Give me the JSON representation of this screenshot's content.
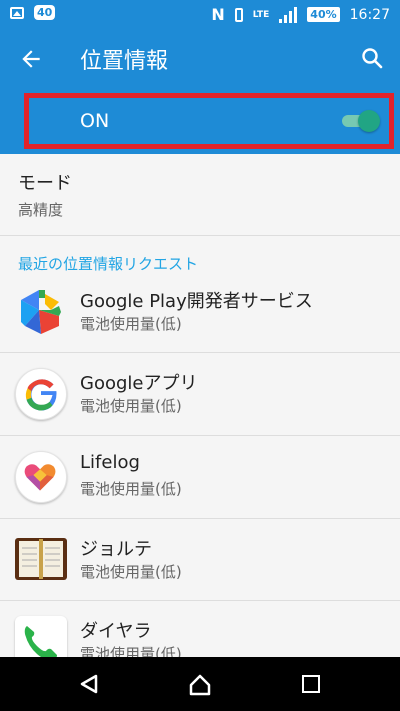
{
  "status_bar": {
    "notification_badge": "40",
    "network": "LTE",
    "battery": "40%",
    "time": "16:27"
  },
  "app_bar": {
    "title": "位置情報"
  },
  "location_toggle": {
    "label": "ON",
    "state": "on"
  },
  "mode": {
    "title": "モード",
    "value": "高精度"
  },
  "recent_requests": {
    "header": "最近の位置情報リクエスト",
    "apps": [
      {
        "name": "Google Play開発者サービス",
        "usage": "電池使用量(低)",
        "icon": "google-play-services-icon"
      },
      {
        "name": "Googleアプリ",
        "usage": "電池使用量(低)",
        "icon": "google-g-icon"
      },
      {
        "name": "Lifelog",
        "usage": "電池使用量(低)",
        "icon": "lifelog-heart-icon"
      },
      {
        "name": "ジョルテ",
        "usage": "電池使用量(低)",
        "icon": "jorte-notebook-icon"
      },
      {
        "name": "ダイヤラ",
        "usage": "電池使用量(低)",
        "icon": "phone-dialer-icon"
      }
    ]
  },
  "colors": {
    "primary": "#1e8bd6",
    "accent": "#21a584",
    "highlight": "#e2232b",
    "section_header": "#22a5e4"
  }
}
